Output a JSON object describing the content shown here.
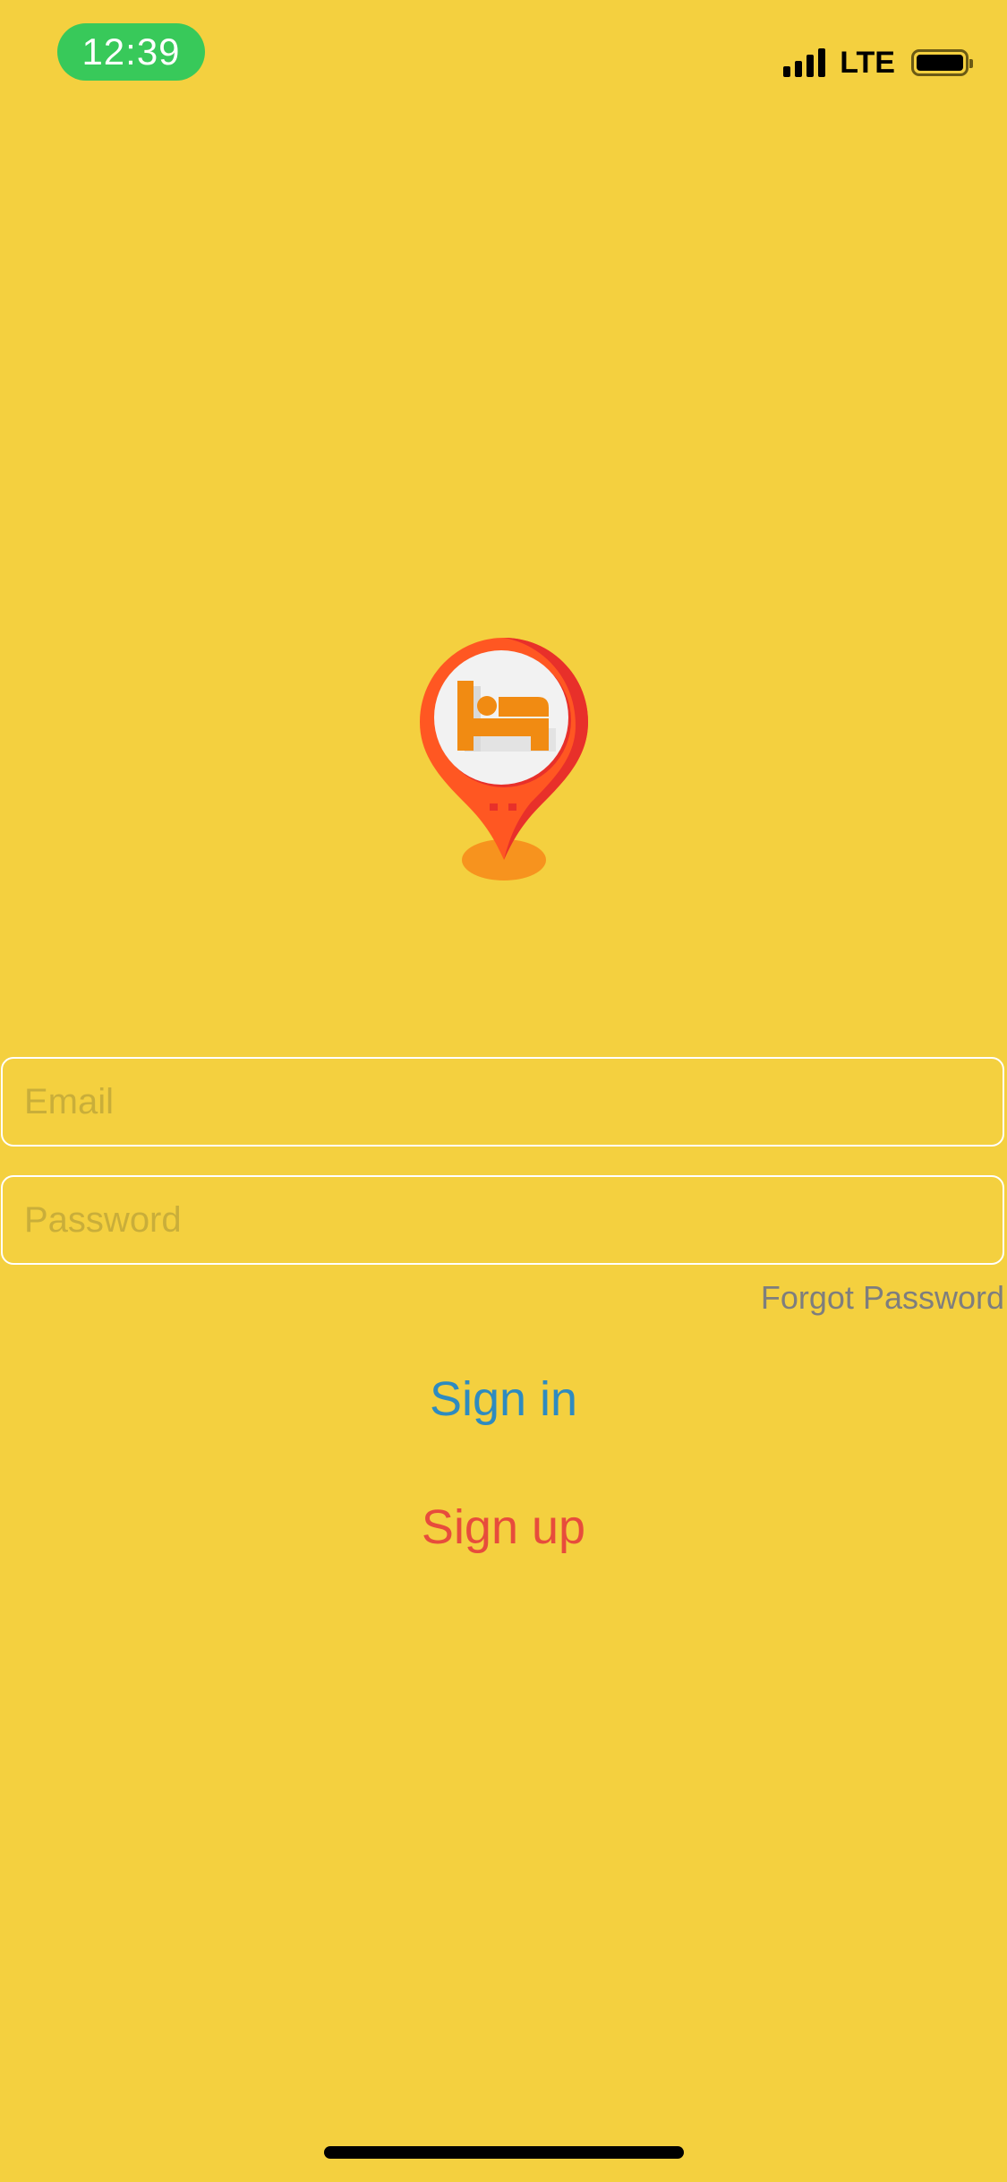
{
  "status_bar": {
    "time": "12:39",
    "network": "LTE",
    "time_pill_color": "#38C95A",
    "signal_bars": 4,
    "battery_icon": "battery-full-icon"
  },
  "logo": {
    "icon": "hotel-bed-map-pin-icon",
    "pin_color": "#FF5722",
    "bed_color": "#F18B12"
  },
  "form": {
    "email_placeholder": "Email",
    "password_placeholder": "Password",
    "forgot_password_label": "Forgot Password"
  },
  "actions": {
    "sign_in_label": "Sign in",
    "sign_up_label": "Sign up",
    "sign_in_color": "#2E8BC0",
    "sign_up_color": "#E74C3C"
  },
  "theme": {
    "background": "#F4D03F"
  }
}
